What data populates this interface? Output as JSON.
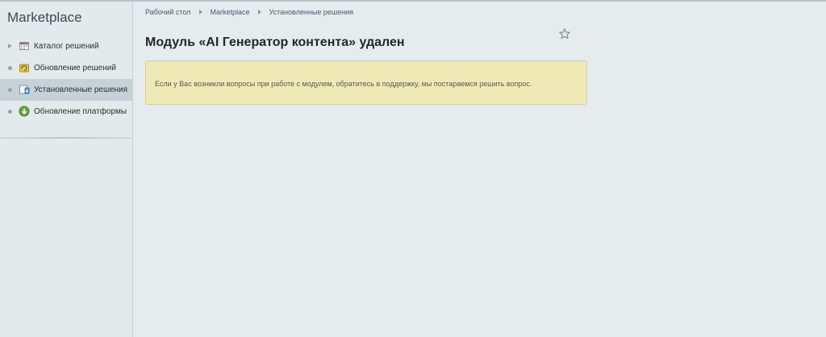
{
  "sidebar": {
    "title": "Marketplace",
    "items": [
      {
        "label": "Каталог решений",
        "icon": "catalog-icon",
        "marker": "arrow"
      },
      {
        "label": "Обновление решений",
        "icon": "update-solutions-icon",
        "marker": "bullet"
      },
      {
        "label": "Установленные решения",
        "icon": "installed-solutions-icon",
        "marker": "bullet",
        "active": true
      },
      {
        "label": "Обновление платформы",
        "icon": "platform-update-icon",
        "marker": "bullet"
      }
    ]
  },
  "breadcrumb": [
    "Рабочий стол",
    "Marketplace",
    "Установленные решения"
  ],
  "page_title": "Модуль «AI Генератор контента» удален",
  "notice": {
    "text": "Если у Вас возникли вопросы при работе с модулем, обратитесь в поддержку, мы постараемся решить вопрос."
  },
  "colors": {
    "active_item": "#c6d2d7",
    "notice_bg": "#efe9b5",
    "link": "#3f5d74"
  }
}
